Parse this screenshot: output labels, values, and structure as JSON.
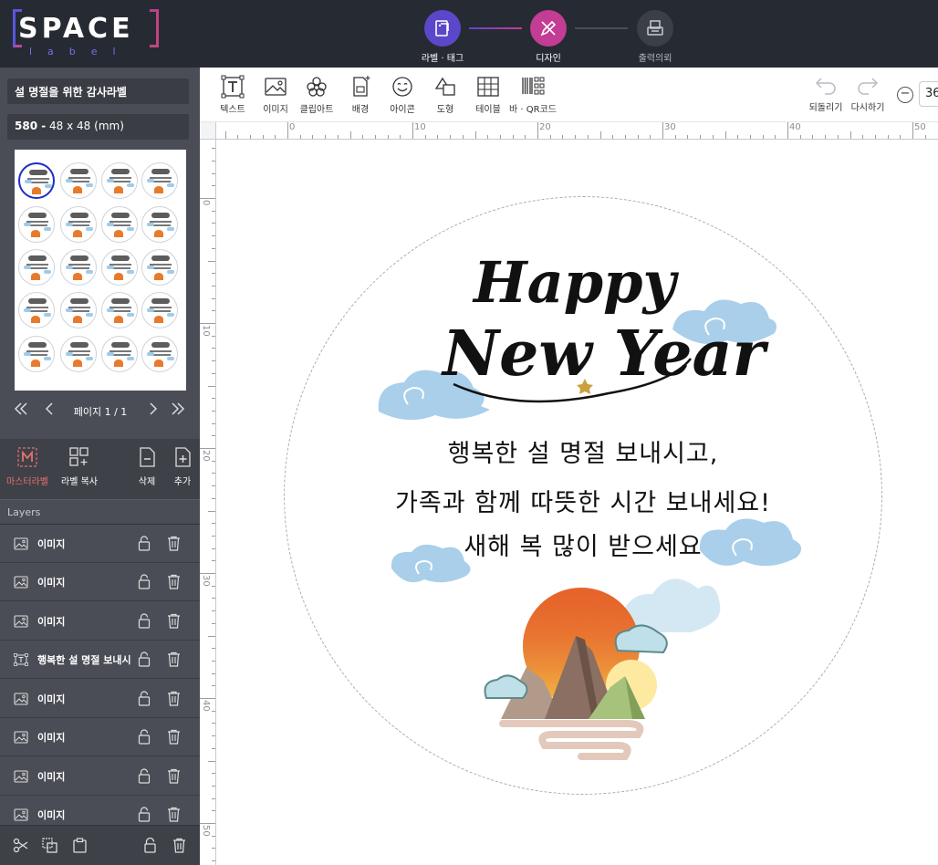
{
  "app": {
    "logo_text": "SPACE",
    "logo_sub": "label"
  },
  "steps": [
    {
      "label": "라벨 · 태그",
      "icon": "label-tag-icon"
    },
    {
      "label": "디자인",
      "icon": "design-pencil-icon"
    },
    {
      "label": "출력의뢰",
      "icon": "printer-icon"
    }
  ],
  "sidebar": {
    "label_name": "설 명절을 위한 감사라벨",
    "size_code": "580 -",
    "size_dims": "48 x 48 (mm)",
    "pager_text": "페이지 1 / 1",
    "tools": [
      {
        "label": "마스터라벨",
        "icon": "master-label-icon"
      },
      {
        "label": "라벨 복사",
        "icon": "copy-label-icon"
      },
      {
        "label": "삭제",
        "icon": "delete-page-icon"
      },
      {
        "label": "추가",
        "icon": "add-page-icon"
      }
    ],
    "layers_title": "Layers",
    "layers": [
      {
        "name": "이미지",
        "type": "image"
      },
      {
        "name": "이미지",
        "type": "image"
      },
      {
        "name": "이미지",
        "type": "image"
      },
      {
        "name": "행복한 설 명절 보내시",
        "type": "text"
      },
      {
        "name": "이미지",
        "type": "image"
      },
      {
        "name": "이미지",
        "type": "image"
      },
      {
        "name": "이미지",
        "type": "image"
      },
      {
        "name": "이미지",
        "type": "image"
      }
    ]
  },
  "toolbar": {
    "tools": [
      {
        "label": "텍스트",
        "icon": "text-icon"
      },
      {
        "label": "이미지",
        "icon": "image-icon"
      },
      {
        "label": "클립아트",
        "icon": "clipart-icon"
      },
      {
        "label": "배경",
        "icon": "background-icon"
      },
      {
        "label": "아이콘",
        "icon": "emoji-icon"
      },
      {
        "label": "도형",
        "icon": "shape-icon"
      },
      {
        "label": "테이블",
        "icon": "table-icon"
      },
      {
        "label": "바 · QR코드",
        "icon": "barcode-icon"
      }
    ],
    "undo_label": "되돌리기",
    "redo_label": "다시하기",
    "zoom_value": "36"
  },
  "ruler": {
    "h_labels": [
      "0",
      "10",
      "20",
      "30",
      "40",
      "50"
    ],
    "v_labels": [
      "0",
      "10",
      "20",
      "30",
      "40",
      "50"
    ]
  },
  "design": {
    "title_art": "Happy New Year",
    "line1": "행복한 설 명절 보내시고,",
    "line2": "가족과 함께 따뜻한 시간 보내세요!",
    "line3": "새해 복 많이 받으세요"
  },
  "colors": {
    "topbar": "#262a33",
    "sidebar": "#4a4d55",
    "step_active1": "#5b47c9",
    "step_active2": "#c23d93",
    "master_label_accent": "#e7706b",
    "selected_thumb": "#1b2fc4",
    "cloud": "#a9cfea",
    "sun": "#e8662b"
  }
}
